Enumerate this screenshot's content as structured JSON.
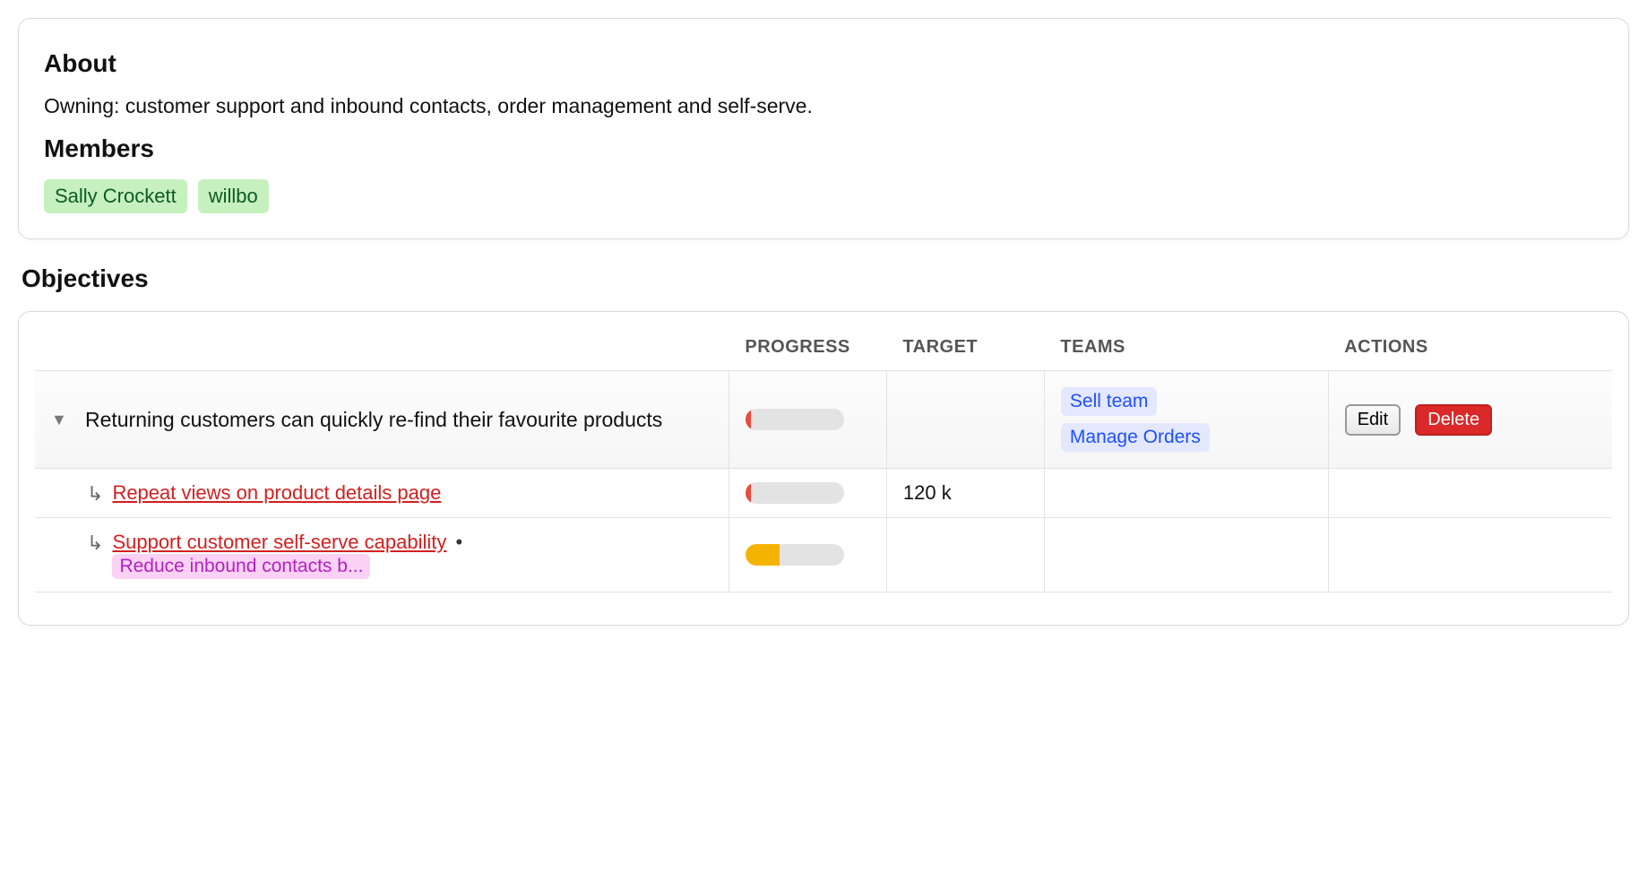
{
  "about": {
    "heading": "About",
    "text": "Owning: customer support and inbound contacts, order management and self-serve."
  },
  "members": {
    "heading": "Members",
    "list": [
      "Sally Crockett",
      "willbo"
    ]
  },
  "objectives": {
    "heading": "Objectives",
    "columns": {
      "progress": "Progress",
      "target": "Target",
      "teams": "Teams",
      "actions": "Actions"
    },
    "rows": [
      {
        "type": "parent",
        "title": "Returning customers can quickly re-find their favourite products",
        "progress": {
          "percent": 6,
          "color": "red"
        },
        "target": "",
        "teams": [
          "Sell team",
          "Manage Orders"
        ],
        "actions": {
          "edit": "Edit",
          "delete": "Delete"
        }
      },
      {
        "type": "child",
        "title": "Repeat views on product details page",
        "progress": {
          "percent": 6,
          "color": "red"
        },
        "target": "120 k",
        "teams": [],
        "actions": {}
      },
      {
        "type": "child",
        "title": "Support customer self-serve capability",
        "tag": "Reduce inbound contacts b...",
        "progress": {
          "percent": 35,
          "color": "yellow"
        },
        "target": "",
        "teams": [],
        "actions": {}
      }
    ]
  }
}
